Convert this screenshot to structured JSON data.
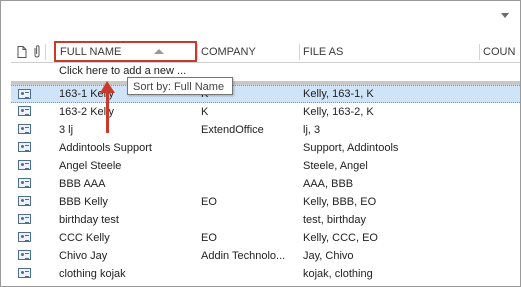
{
  "header": {
    "full_name": "FULL NAME",
    "company": "COMPANY",
    "file_as": "FILE AS",
    "country": "COUN"
  },
  "add_new": "Click here to add a new ...",
  "tooltip": "Sort by: Full Name",
  "colors": {
    "highlight": "#c83a2a",
    "selected_row": "#cfe4f8"
  },
  "rows": [
    {
      "name": "163-1 Kelly",
      "company": "K",
      "file_as": "Kelly, 163-1, K"
    },
    {
      "name": "163-2 Kelly",
      "company": "K",
      "file_as": "Kelly, 163-2, K"
    },
    {
      "name": "3 lj",
      "company": "ExtendOffice",
      "file_as": "lj, 3"
    },
    {
      "name": "Addintools Support",
      "company": "",
      "file_as": "Support, Addintools"
    },
    {
      "name": "Angel Steele",
      "company": "",
      "file_as": "Steele, Angel"
    },
    {
      "name": "BBB AAA",
      "company": "",
      "file_as": "AAA, BBB"
    },
    {
      "name": "BBB Kelly",
      "company": "EO",
      "file_as": "Kelly, BBB, EO"
    },
    {
      "name": "birthday test",
      "company": "",
      "file_as": "test, birthday"
    },
    {
      "name": "CCC Kelly",
      "company": "EO",
      "file_as": "Kelly, CCC, EO"
    },
    {
      "name": "Chivo Jay",
      "company": "Addin Technolo...",
      "file_as": "Jay, Chivo"
    },
    {
      "name": "clothing kojak",
      "company": "",
      "file_as": "kojak, clothing"
    }
  ]
}
